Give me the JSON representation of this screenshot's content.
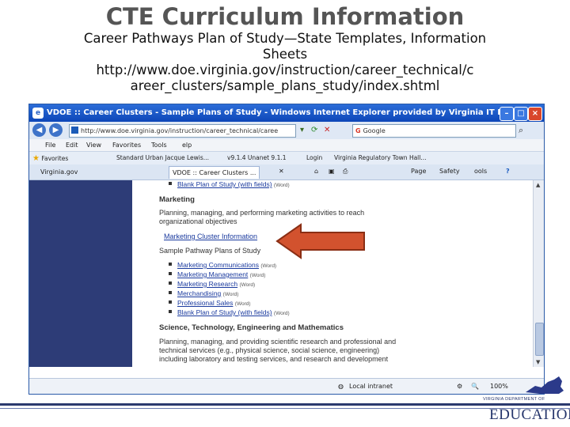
{
  "slide": {
    "title": "CTE Curriculum Information",
    "subtitle_lines": [
      "Career Pathways Plan of Study—State Templates, Information",
      "Sheets",
      "http://www.doe.virginia.gov/instruction/career_technical/c",
      "areer_clusters/sample_plans_study/index.shtml"
    ]
  },
  "browser": {
    "window_title": "VDOE :: Career Clusters - Sample Plans of Study - Windows Internet Explorer provided by Virginia IT Partner...",
    "url": "http://www.doe.virginia.gov/instruction/career_technical/caree",
    "search_placeholder": "Google",
    "menu": [
      "File",
      "Edit",
      "View",
      "Favorites",
      "Tools",
      "elp"
    ],
    "links_bar": {
      "favorites": "Favorites",
      "items": [
        "Standard Urban Jacque Lewis...",
        "v9.1.4 Unanet 9.1.1",
        "Login",
        "Virginia Regulatory Town Hall..."
      ]
    },
    "tabs": [
      "Virginia.gov",
      "VDOE :: Career Clusters ..."
    ],
    "tools": [
      "Page",
      "Safety",
      "ools",
      "?"
    ],
    "status": {
      "zone": "Local intranet",
      "zoom": "100%"
    }
  },
  "page": {
    "top_link": "Blank Plan of Study (with fields)",
    "top_link_note": "(Word)",
    "section_marketing": {
      "heading": "Marketing",
      "desc_line1": "Planning, managing, and performing marketing activities to reach",
      "desc_line2": "organizational objectives",
      "info_link": "Marketing Cluster Information",
      "sample_label": "Sample Pathway Plans of Study",
      "items": [
        {
          "label": "Marketing Communications",
          "note": "(Word)"
        },
        {
          "label": "Marketing Management",
          "note": "(Word)"
        },
        {
          "label": "Marketing Research",
          "note": "(Word)"
        },
        {
          "label": "Merchandising",
          "note": "(Word)"
        },
        {
          "label": "Professional Sales",
          "note": "(Word)"
        },
        {
          "label": "Blank Plan of Study (with fields)",
          "note": "(Word)"
        }
      ]
    },
    "section_stem": {
      "heading": "Science, Technology, Engineering and Mathematics",
      "desc_line1": "Planning, managing, and providing scientific research and professional and",
      "desc_line2": "technical services (e.g., physical science, social science, engineering)",
      "desc_line3": "including laboratory and testing services, and research and development"
    }
  },
  "logo": {
    "small_text": "VIRGINIA DEPARTMENT OF",
    "big_text": "EDUCATION"
  },
  "colors": {
    "sidebar": "#2d3c77",
    "arrow": "#d2522e",
    "link": "#1a3a9e"
  }
}
